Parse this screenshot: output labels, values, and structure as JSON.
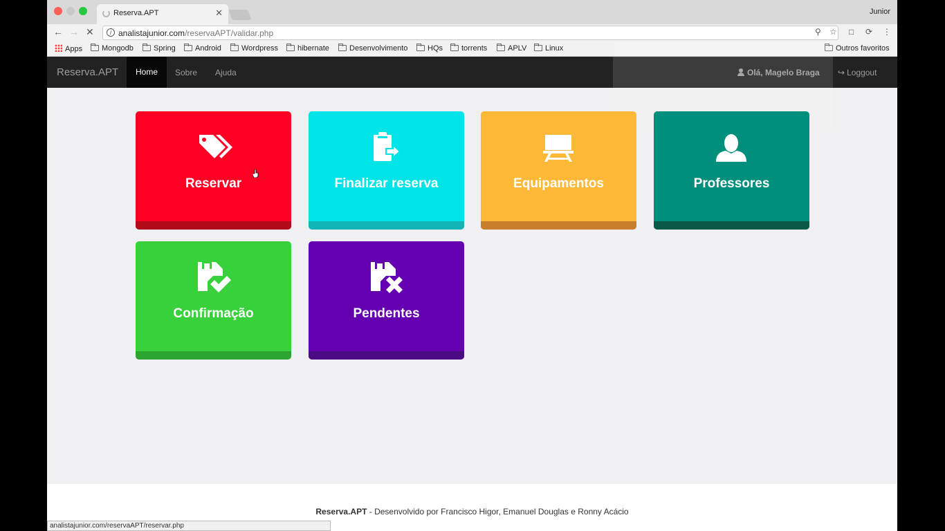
{
  "browser": {
    "tab_title": "Reserva.APT",
    "tab_close": "✕",
    "profile_name": "Junior",
    "url_host": "analistajunior.com",
    "url_path": "/reservaAPT/validar.php",
    "bookmarks": [
      "Apps",
      "Mongodb",
      "Spring",
      "Android",
      "Wordpress",
      "hibernate",
      "Desenvolvimento",
      "HQs",
      "torrents",
      "APLV",
      "Linux"
    ],
    "other_bookmarks": "Outros favoritos",
    "status_url": "analistajunior.com/reservaAPT/reservar.php"
  },
  "navbar": {
    "brand": "Reserva.APT",
    "links": [
      "Home",
      "Sobre",
      "Ajuda"
    ],
    "user_greeting": "Olá, Magelo Braga",
    "logout": "Loggout"
  },
  "tiles": [
    {
      "label": "Reservar",
      "icon": "tags-icon",
      "color": "#ff0025"
    },
    {
      "label": "Finalizar reserva",
      "icon": "clipboard-export-icon",
      "color": "#00e4e8"
    },
    {
      "label": "Equipamentos",
      "icon": "projector-screen-icon",
      "color": "#fdb838"
    },
    {
      "label": "Professores",
      "icon": "user-icon",
      "color": "#008f7d"
    },
    {
      "label": "Confirmação",
      "icon": "calendar-check-icon",
      "color": "#38d13b"
    },
    {
      "label": "Pendentes",
      "icon": "calendar-remove-icon",
      "color": "#6500b0"
    }
  ],
  "footer": {
    "brand": "Reserva.APT",
    "credits": " - Desenvolvido por Francisco Higor, Emanuel Douglas e Ronny Acácio"
  }
}
